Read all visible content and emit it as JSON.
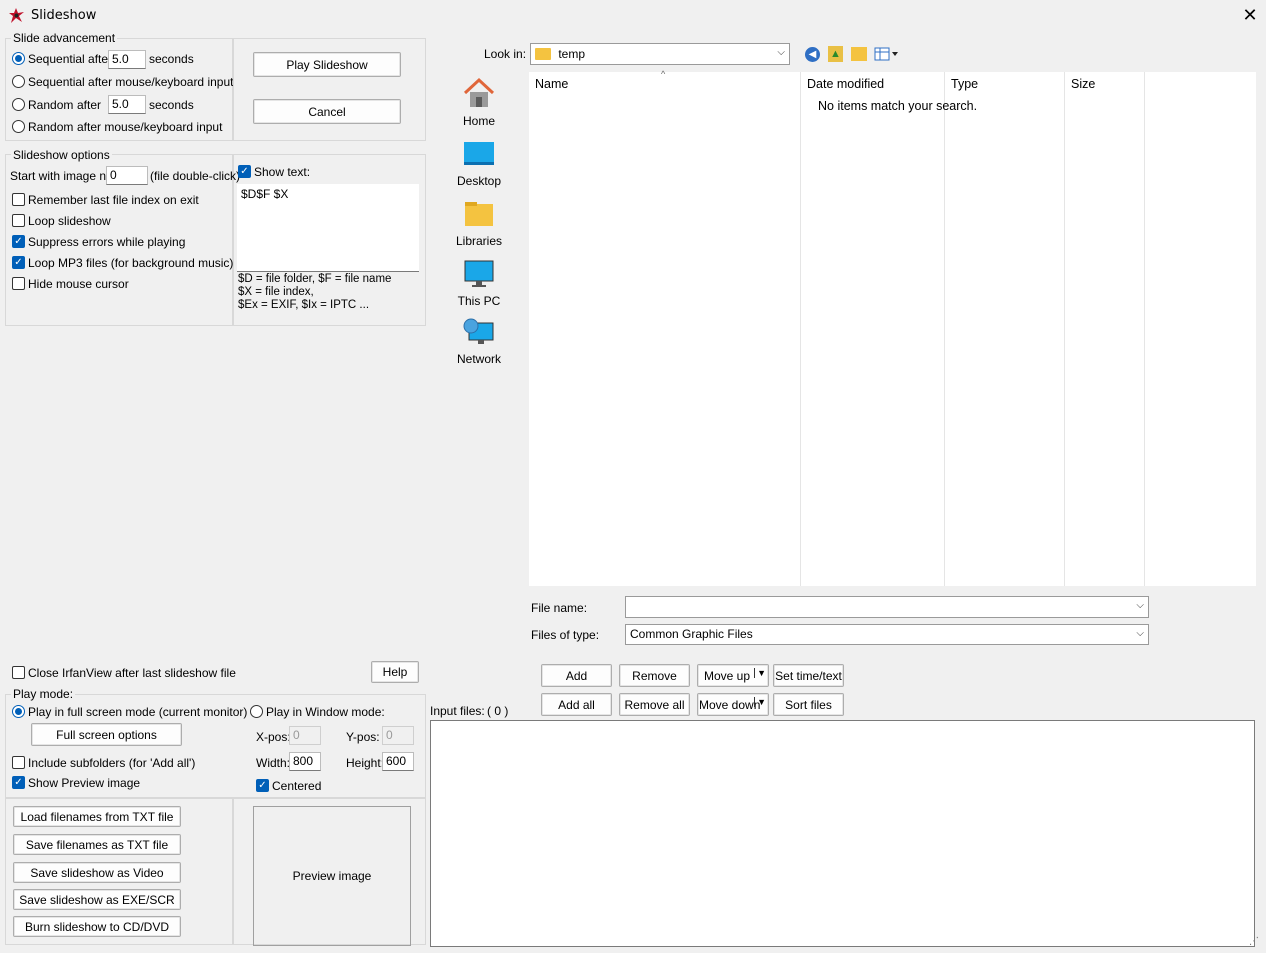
{
  "window": {
    "title": "Slideshow",
    "close_label": "✕",
    "app_icon": "irfanview-icon"
  },
  "slide_advancement": {
    "legend": "Slide advancement",
    "opt1_label": "Sequential after",
    "opt1_value": "5.0",
    "opt1_unit": "seconds",
    "opt2_label": "Sequential after mouse/keyboard input",
    "opt3_label": "Random",
    "opt3_after": "after",
    "opt3_value": "5.0",
    "opt3_unit": "seconds",
    "opt4_label": "Random",
    "opt4_after": "after mouse/keyboard input"
  },
  "actions": {
    "play_label": "Play Slideshow",
    "cancel_label": "Cancel"
  },
  "slideshow_options": {
    "legend": "Slideshow options",
    "start_label": "Start with image nr.:",
    "start_value": "0",
    "start_hint": "(file double-click)",
    "remember_label": "Remember last file index on exit",
    "loop_label": "Loop slideshow",
    "suppress_label": "Suppress errors while playing",
    "loop_mp3_label": "Loop MP3 files (for background music)",
    "hide_cursor_label": "Hide mouse cursor",
    "show_text_label": "Show text:",
    "show_text_value": "$D$F $X",
    "help1": "$D = file folder, $F = file name",
    "help2": "$X = file index,",
    "help3": "$Ex = EXIF, $Ix = IPTC ..."
  },
  "file_browser": {
    "look_in_label": "Look in:",
    "look_in_value": "temp",
    "places": [
      {
        "label": "Home",
        "icon": "home-icon"
      },
      {
        "label": "Desktop",
        "icon": "desktop-icon"
      },
      {
        "label": "Libraries",
        "icon": "libraries-icon"
      },
      {
        "label": "This PC",
        "icon": "this-pc-icon"
      },
      {
        "label": "Network",
        "icon": "network-icon"
      }
    ],
    "columns": {
      "name": "Name",
      "date": "Date modified",
      "type": "Type",
      "size": "Size"
    },
    "empty_message": "No items match your search.",
    "file_name_label": "File name:",
    "file_name_value": "",
    "files_of_type_label": "Files of type:",
    "files_of_type_value": "Common Graphic Files"
  },
  "list_buttons": {
    "add": "Add",
    "remove": "Remove",
    "move_up": "Move up",
    "set_time": "Set time/text",
    "add_all": "Add all",
    "remove_all": "Remove all",
    "move_down": "Move down",
    "sort": "Sort files"
  },
  "input_files": {
    "label": "Input files:",
    "count": "( 0 )"
  },
  "bottom_left": {
    "close_after_label": "Close IrfanView after last slideshow file",
    "help_label": "Help",
    "play_mode_legend": "Play mode:",
    "fullscreen_label": "Play in full screen mode (current monitor)",
    "window_label": "Play in Window mode:",
    "fullscreen_options_label": "Full screen options",
    "xpos_label": "X-pos:",
    "xpos_value": "0",
    "ypos_label": "Y-pos:",
    "ypos_value": "0",
    "width_label": "Width:",
    "width_value": "800",
    "height_label": "Height:",
    "height_value": "600",
    "include_sub_label": "Include subfolders (for 'Add all')",
    "show_preview_label": "Show Preview image",
    "centered_label": "Centered",
    "load_txt": "Load filenames from TXT file",
    "save_txt": "Save filenames as TXT file",
    "save_video": "Save slideshow as Video",
    "save_exe": "Save slideshow as  EXE/SCR",
    "burn_cd": "Burn slideshow to CD/DVD",
    "preview_label": "Preview image"
  }
}
